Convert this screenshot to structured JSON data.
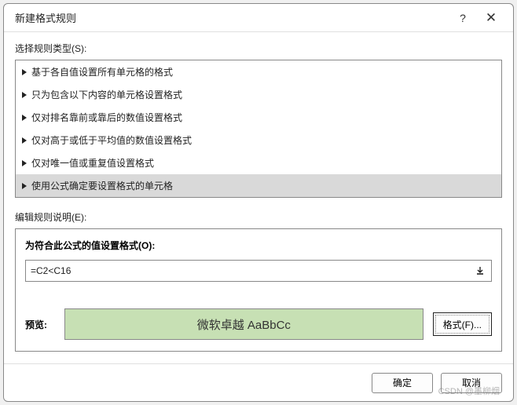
{
  "titlebar": {
    "title": "新建格式规则",
    "help": "?",
    "close": "✕"
  },
  "selectRuleLabel": "选择规则类型(S):",
  "ruleTypes": [
    "基于各自值设置所有单元格的格式",
    "只为包含以下内容的单元格设置格式",
    "仅对排名靠前或靠后的数值设置格式",
    "仅对高于或低于平均值的数值设置格式",
    "仅对唯一值或重复值设置格式",
    "使用公式确定要设置格式的单元格"
  ],
  "editRuleLabel": "编辑规则说明(E):",
  "formulaPanelLabel": "为符合此公式的值设置格式(O):",
  "formulaValue": "=C2<C16",
  "preview": {
    "label": "预览:",
    "sample": "微软卓越 AaBbCc",
    "bg": "#c7e0b4"
  },
  "formatBtn": "格式(F)...",
  "okBtn": "确定",
  "cancelBtn": "取消",
  "watermark": "CSDN @墨柳烟"
}
